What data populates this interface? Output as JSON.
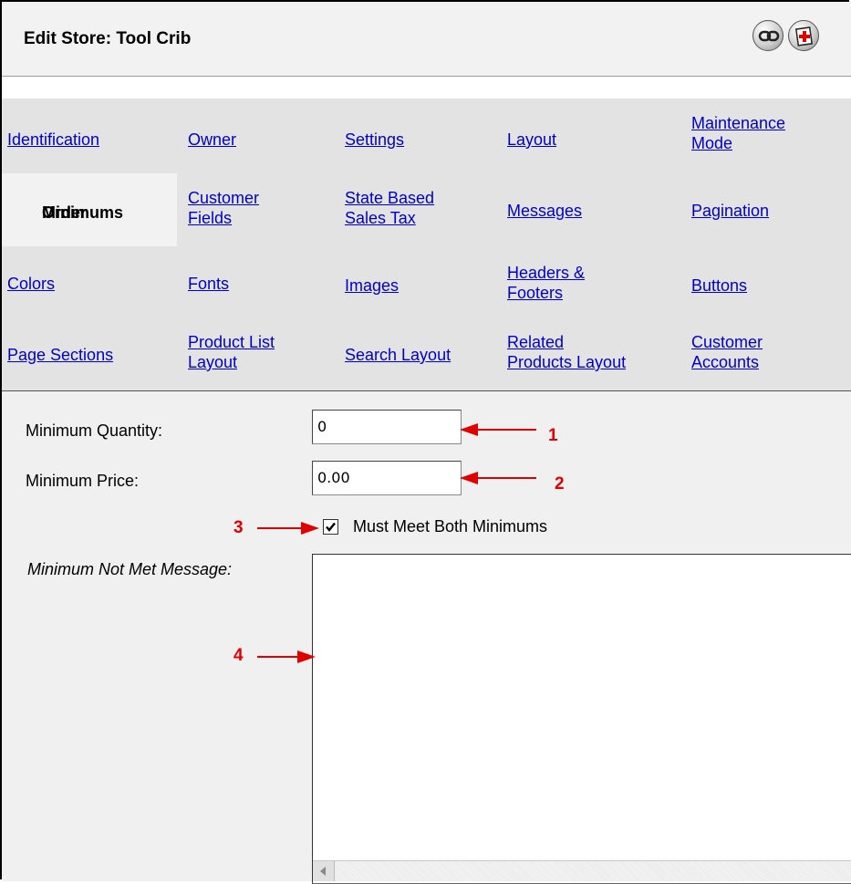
{
  "header": {
    "title": "Edit Store: Tool Crib"
  },
  "icons": {
    "link": "chain-link-icon",
    "help": "help-icon"
  },
  "tabs": [
    [
      "Identification",
      "Owner",
      "Settings",
      "Layout",
      "Maintenance Mode"
    ],
    [
      "Order Minimums",
      "Customer Fields",
      "State Based Sales Tax",
      "Messages",
      "Pagination"
    ],
    [
      "Colors",
      "Fonts",
      "Images",
      "Headers & Footers",
      "Buttons"
    ],
    [
      "Page Sections",
      "Product List Layout",
      "Search Layout",
      "Related Products Layout",
      "Customer Accounts"
    ]
  ],
  "tab_labels": {
    "identification": "Identification",
    "owner": "Owner",
    "settings": "Settings",
    "layout": "Layout",
    "maintenance_1": "Maintenance",
    "maintenance_2": "Mode",
    "order_1": "Order",
    "order_2": "Minimums",
    "customer_fields_1": "Customer",
    "customer_fields_2": "Fields",
    "sbst_1": "State Based",
    "sbst_2": "Sales Tax",
    "messages": "Messages",
    "pagination": "Pagination",
    "colors": "Colors",
    "fonts": "Fonts",
    "images": "Images",
    "hf_1": "Headers &",
    "hf_2": "Footers",
    "buttons": "Buttons",
    "page_sections": "Page Sections",
    "pll_1": "Product List",
    "pll_2": "Layout",
    "search_layout": "Search Layout",
    "rpl_1": "Related",
    "rpl_2": "Products Layout",
    "ca_1": "Customer",
    "ca_2": "Accounts"
  },
  "active_tab": "Order Minimums",
  "form": {
    "min_quantity_label": "Minimum Quantity:",
    "min_quantity_value": "0",
    "min_price_label": "Minimum Price:",
    "min_price_value": "0.00",
    "both_label": "Must Meet Both Minimums",
    "both_checked": true,
    "message_label": "Minimum Not Met Message:",
    "message_value": ""
  },
  "callouts": {
    "c1": "1",
    "c2": "2",
    "c3": "3",
    "c4": "4"
  },
  "colors": {
    "callout": "#e00000",
    "link": "#0000cc",
    "tab_bar": "#e3e3e3"
  }
}
